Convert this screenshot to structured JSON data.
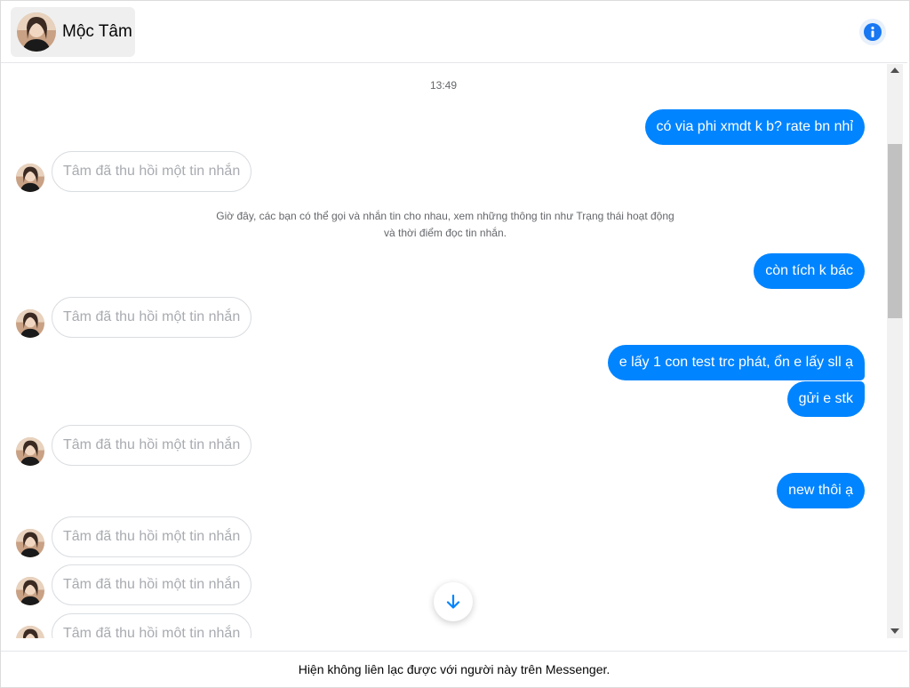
{
  "header": {
    "contact_name": "Mộc Tâm",
    "info_icon": "info-icon"
  },
  "conversation": {
    "timestamp": "13:49",
    "system_note": "Giờ đây, các bạn có thể gọi và nhắn tin cho nhau, xem những thông tin như Trạng thái hoạt động và thời điểm đọc tin nhắn.",
    "outgoing": [
      "có via phi xmdt k b? rate bn nhỉ",
      "còn tích k bác",
      "e lấy 1 con test trc phát, ổn e lấy sll ạ",
      "gửi e stk",
      "new thôi ạ"
    ],
    "unsent_label": "Tâm đã thu hồi một tin nhắn"
  },
  "footer": {
    "notice": "Hiện không liên lạc được với người này trên Messenger."
  },
  "colors": {
    "outgoing_bubble": "#0084ff",
    "accent": "#1877f2",
    "unsent_text": "#a8abb0"
  }
}
